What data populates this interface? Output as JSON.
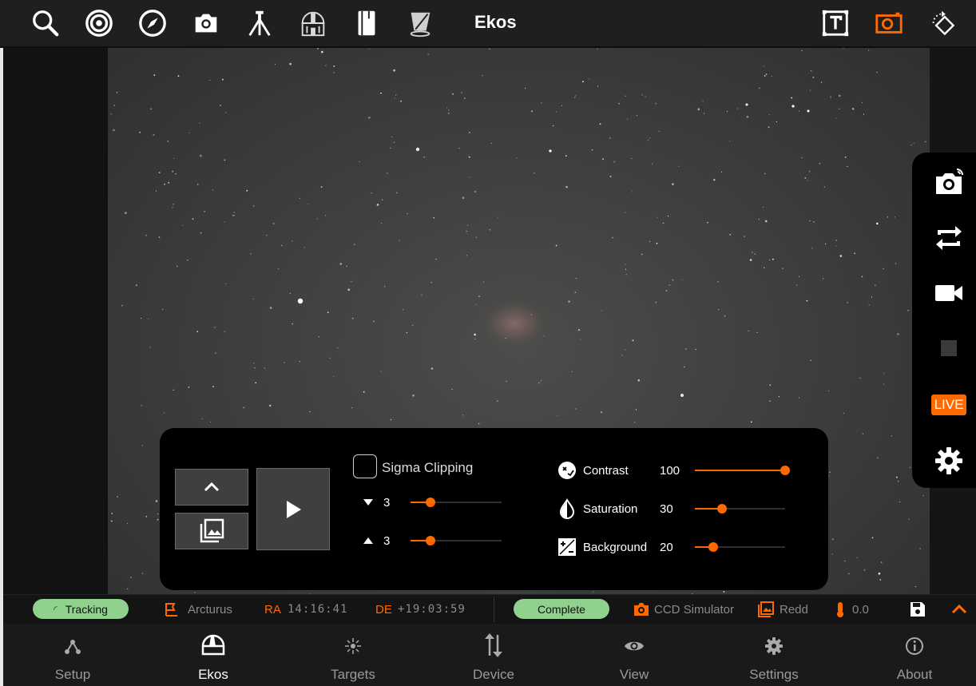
{
  "app": {
    "title": "Ekos"
  },
  "toolbar": {
    "icons": [
      "search-icon",
      "target-icon",
      "compass-icon",
      "camera-icon",
      "telescope-tripod-icon",
      "observatory-dome-icon",
      "notebook-icon",
      "flat-panel-icon"
    ],
    "right_icons": [
      "text-frame-icon",
      "capture-frame-icon",
      "rotate-diamond-icon"
    ]
  },
  "capture_panel": {
    "buttons": [
      "capture-camera-icon",
      "loop-icon",
      "video-icon",
      "stop-icon"
    ],
    "live_label": "LIVE",
    "settings_icon": "gear-icon"
  },
  "stretch_panel": {
    "sigma_clipping": {
      "label": "Sigma Clipping",
      "checked": false
    },
    "sigma_low": {
      "value": "3",
      "fraction": 0.22
    },
    "sigma_high": {
      "value": "3",
      "fraction": 0.22
    },
    "contrast": {
      "label": "Contrast",
      "value": "100",
      "fraction": 1.0
    },
    "saturation": {
      "label": "Saturation",
      "value": "30",
      "fraction": 0.3
    },
    "background": {
      "label": "Background",
      "value": "20",
      "fraction": 0.2
    }
  },
  "status": {
    "mount_state": "Tracking",
    "target": "Arcturus",
    "ra_label": "RA",
    "ra_value": "14:16:41",
    "de_label": "DE",
    "de_value": "+19:03:59",
    "capture_state": "Complete",
    "camera": "CCD Simulator",
    "filter": "Redd",
    "temperature": "0.0"
  },
  "nav": [
    {
      "label": "Setup",
      "icon": "network-icon"
    },
    {
      "label": "Ekos",
      "icon": "dome-icon"
    },
    {
      "label": "Targets",
      "icon": "star-icon"
    },
    {
      "label": "Device",
      "icon": "updown-arrows-icon"
    },
    {
      "label": "View",
      "icon": "eye-icon"
    },
    {
      "label": "Settings",
      "icon": "gear-icon"
    },
    {
      "label": "About",
      "icon": "info-icon"
    }
  ],
  "colors": {
    "accent": "#ff6a00",
    "pill": "#8fd18d",
    "toolbar": "#1f1f1f"
  }
}
